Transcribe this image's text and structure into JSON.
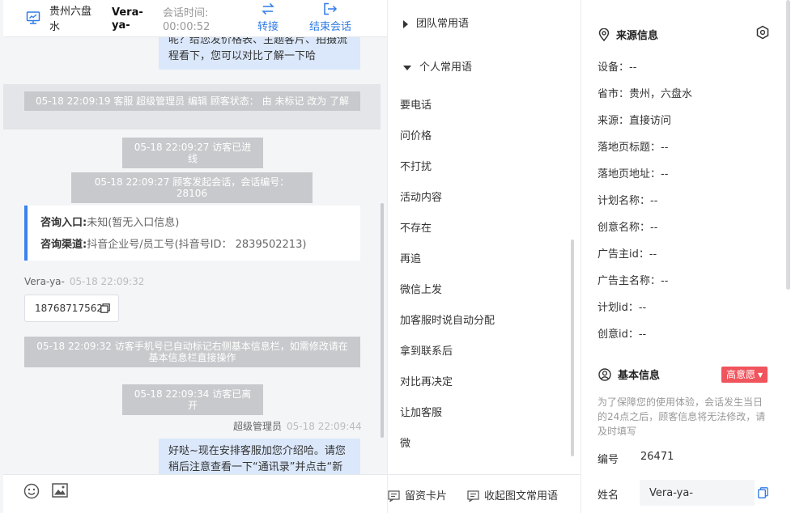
{
  "header": {
    "location": "贵州六盘水",
    "user": "Vera-ya-",
    "time_label": "会话时间:",
    "time_value": "00:00:52",
    "transfer_label": "转接",
    "end_label": "结束会话"
  },
  "chat": {
    "bubble_top": "呢？给您发价格表、主题客片、拍摄流程看下，您可以对比了解一下哈",
    "sys1": "05-18 22:09:19 客服 超级管理员 编辑 顾客状态： 由 未标记 改为 了解",
    "sys2": "05-18 22:09:27 访客已进线",
    "sys3": "05-18 22:09:27 顾客发起会话，会话编号：28106",
    "card": {
      "entry_label": "咨询入口:",
      "entry_value": "未知(暂无入口信息)",
      "channel_label": "咨询渠道:",
      "channel_value": "抖音企业号/员工号(抖音号ID： 2839502213)"
    },
    "visitor_name": "Vera-ya-",
    "visitor_time": "05-18 22:09:32",
    "phone": "18768717562",
    "sys4": "05-18 22:09:32 访客手机号已自动标记右侧基本信息栏，如需修改请在基本信息栏直接操作",
    "sys5": "05-18 22:09:34 访客已离开",
    "agent_name": "超级管理员",
    "agent_time": "05-18 22:09:44",
    "bubble_bottom": "好哒~现在安排客服加您介绍哈。请您稍后注意查看一下“通讯录”并点击“新的"
  },
  "middle": {
    "group_team": "团队常用语",
    "group_personal": "个人常用语",
    "phrases": [
      "要电话",
      "问价格",
      "不打扰",
      "活动内容",
      "不存在",
      "再追",
      "微信上发",
      "加客服时说自动分配",
      "拿到联系后",
      "对比再决定",
      "让加客服",
      "微"
    ],
    "footer_card": "留资卡片",
    "footer_collapse": "收起图文常用语"
  },
  "right": {
    "source_title": "来源信息",
    "rows": [
      "设备：--",
      "省市：贵州，六盘水",
      "来源：直接访问",
      "落地页标题：--",
      "落地页地址：--",
      "计划名称：--",
      "创意名称：--",
      "广告主id：--",
      "广告主名称：--",
      "计划id：--",
      "创意id：--"
    ],
    "basic_title": "基本信息",
    "intent_tag": "高意愿",
    "note": "为了保障您的使用体验，会话发生当日的24点之后，顾客信息将无法修改，请及时填写",
    "id_label": "编号",
    "id_value": "26471",
    "name_label": "姓名",
    "name_value": "Vera-ya-"
  },
  "colors": {
    "accent": "#2f7ae5",
    "bubble": "#dbe8fb",
    "system": "#c8c9cc",
    "intent": "#f0545c"
  }
}
